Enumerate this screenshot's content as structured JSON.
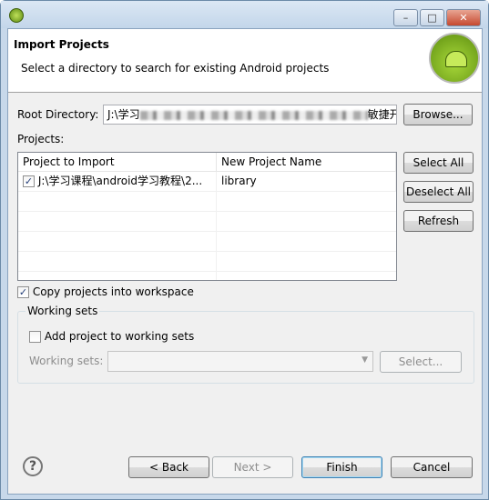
{
  "window": {
    "minimize": "–",
    "maximize": "□",
    "close": "✕"
  },
  "header": {
    "title": "Import Projects",
    "description": "Select a directory to search for existing Android projects"
  },
  "root": {
    "label": "Root Directory:",
    "value_start": "J:\\学习",
    "value_end": "敏捷开",
    "browse": "Browse..."
  },
  "projects": {
    "label": "Projects:",
    "columns": [
      "Project to Import",
      "New Project Name"
    ],
    "rows": [
      {
        "checked": true,
        "check": "✓",
        "path": "J:\\学习课程\\android学习教程\\2...",
        "name": "library"
      }
    ]
  },
  "buttons": {
    "select_all": "Select All",
    "deselect_all": "Deselect All",
    "refresh": "Refresh"
  },
  "copy": {
    "checked": true,
    "check": "✓",
    "label": "Copy projects into workspace"
  },
  "working_sets": {
    "title": "Working sets",
    "add_label": "Add project to working sets",
    "add_checked": false,
    "sets_label": "Working sets:",
    "sets_value": "",
    "select": "Select..."
  },
  "footer": {
    "help": "?",
    "back": "< Back",
    "next": "Next >",
    "finish": "Finish",
    "cancel": "Cancel"
  }
}
